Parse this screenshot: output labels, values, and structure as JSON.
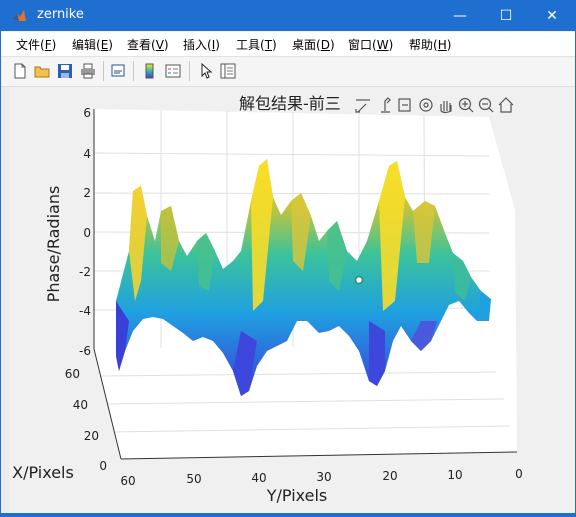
{
  "window": {
    "title": "zernike"
  },
  "menus": [
    {
      "label": "文件(",
      "key": "F",
      "tail": ")"
    },
    {
      "label": "编辑(",
      "key": "E",
      "tail": ")"
    },
    {
      "label": "查看(",
      "key": "V",
      "tail": ")"
    },
    {
      "label": "插入(",
      "key": "I",
      "tail": ")"
    },
    {
      "label": "工具(",
      "key": "T",
      "tail": ")"
    },
    {
      "label": "桌面(",
      "key": "D",
      "tail": ")"
    },
    {
      "label": "窗口(",
      "key": "W",
      "tail": ")"
    },
    {
      "label": "帮助(",
      "key": "H",
      "tail": ")"
    }
  ],
  "plot": {
    "title": "解包结果-前三",
    "zlabel": "Phase/Radians",
    "xlabel": "X/Pixels",
    "ylabel": "Y/Pixels",
    "z_ticks": [
      "6",
      "4",
      "2",
      "0",
      "-2",
      "-4",
      "-6"
    ],
    "x_ticks": [
      "60",
      "40",
      "20",
      "0"
    ],
    "y_ticks": [
      "60",
      "50",
      "40",
      "30",
      "20",
      "10",
      "0"
    ]
  },
  "chart_data": {
    "type": "surface",
    "title": "解包结果-前三",
    "xlabel": "X/Pixels",
    "ylabel": "Y/Pixels",
    "zlabel": "Phase/Radians",
    "zlim": [
      -6,
      6
    ],
    "xlim": [
      0,
      60
    ],
    "ylim": [
      0,
      60
    ],
    "grid": true,
    "colormap": "parula"
  },
  "colors": {
    "titlebar": "#1f6fd1",
    "menu_bg": "#ffffff",
    "toolbar_bg": "#f5f5f5",
    "figure_bg": "#f0f0f0"
  }
}
